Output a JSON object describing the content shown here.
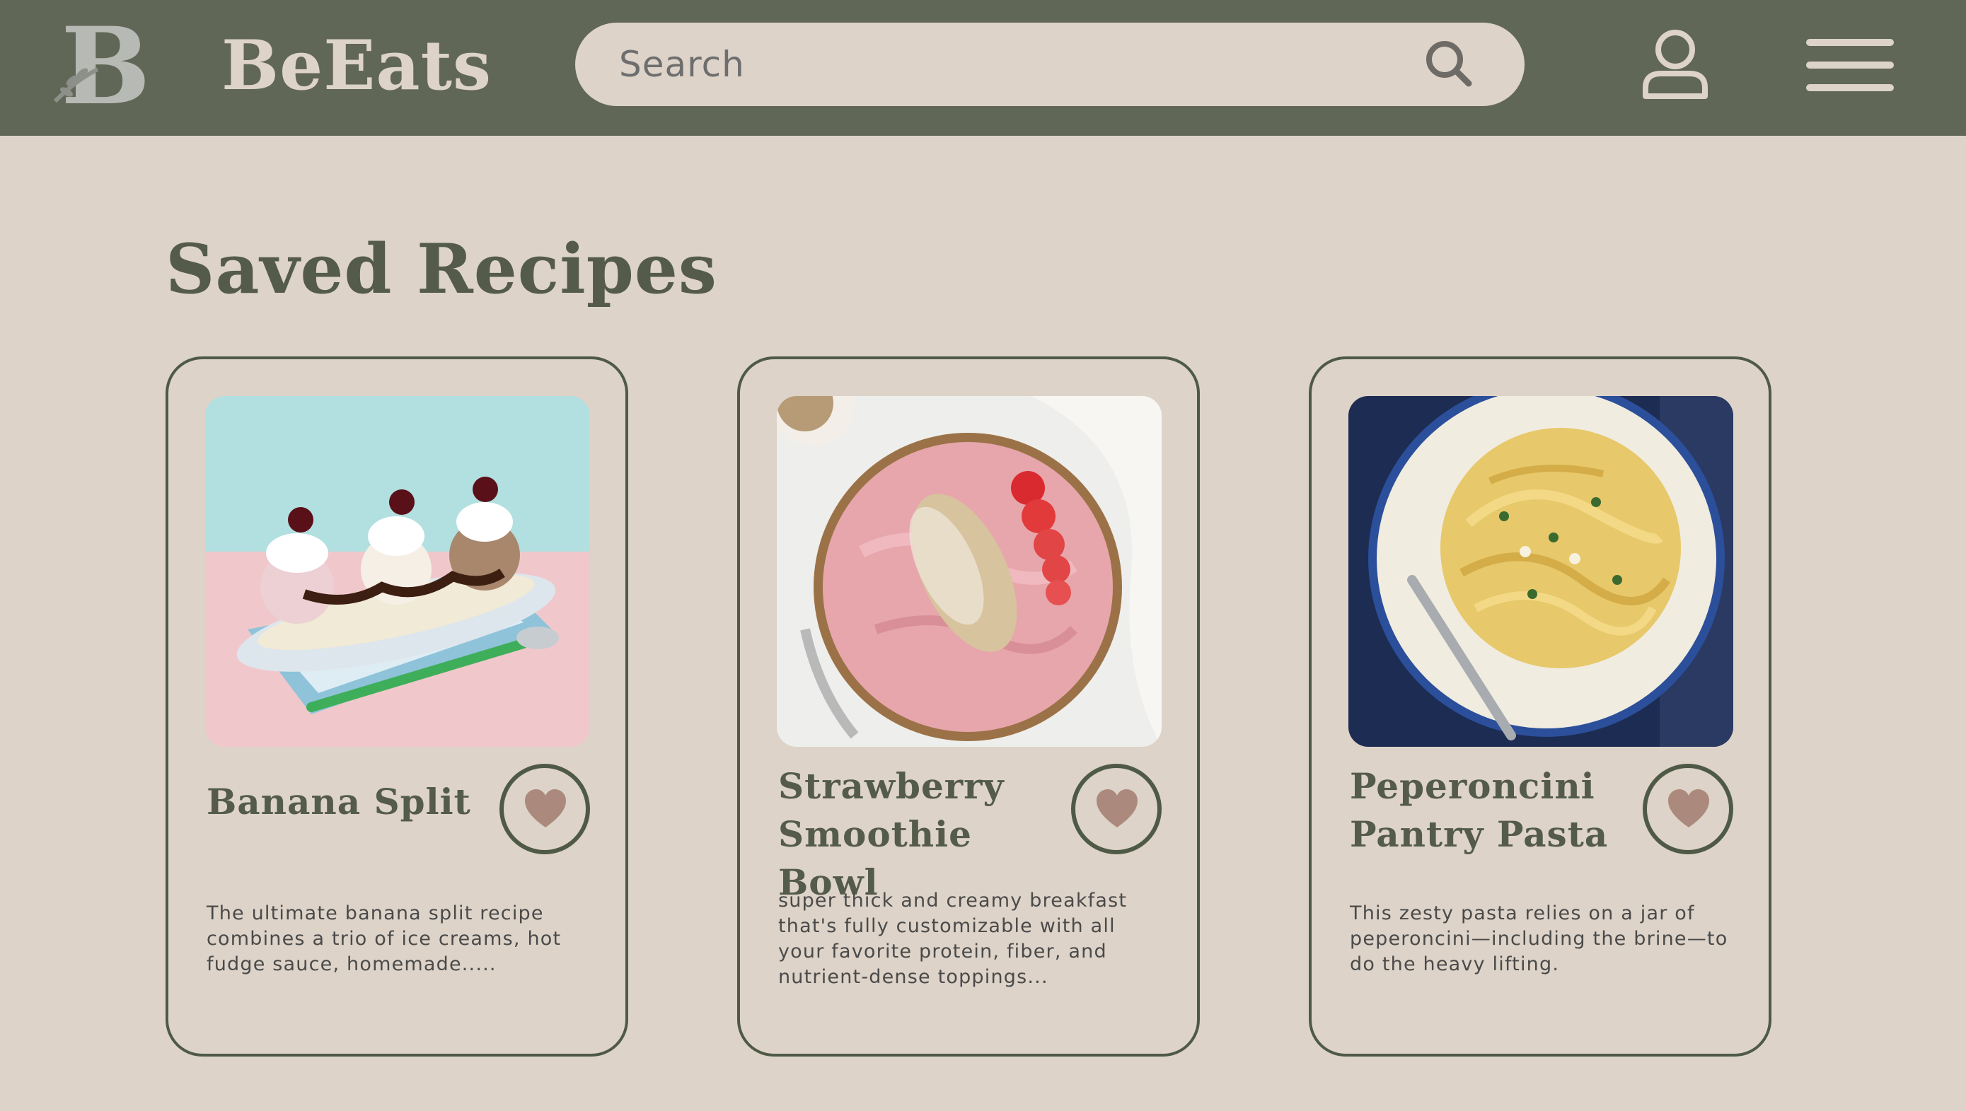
{
  "header": {
    "brand": "BeEats",
    "search": {
      "placeholder": "Search",
      "value": ""
    },
    "icons": [
      "logo-icon",
      "search-icon",
      "user-icon",
      "menu-icon"
    ]
  },
  "main": {
    "title": "Saved Recipes",
    "recipes": [
      {
        "title": "Banana Split",
        "description": "The ultimate banana split recipe combines a trio of ice creams, hot fudge sauce, homemade.....",
        "saved": true
      },
      {
        "title": "Strawberry Smoothie Bowl",
        "description": "super thick and creamy breakfast that's fully customizable with all your favorite protein, fiber, and nutrient-dense toppings...",
        "saved": true
      },
      {
        "title": "Peperoncini Pantry Pasta",
        "description": "This zesty pasta relies on a jar of peperoncini—including the brine—to do the heavy lifting.",
        "saved": true
      }
    ]
  },
  "colors": {
    "background": "#ddd3c8",
    "header": "#616757",
    "accent": "#545b4a",
    "heart": "#ab8a7d"
  }
}
